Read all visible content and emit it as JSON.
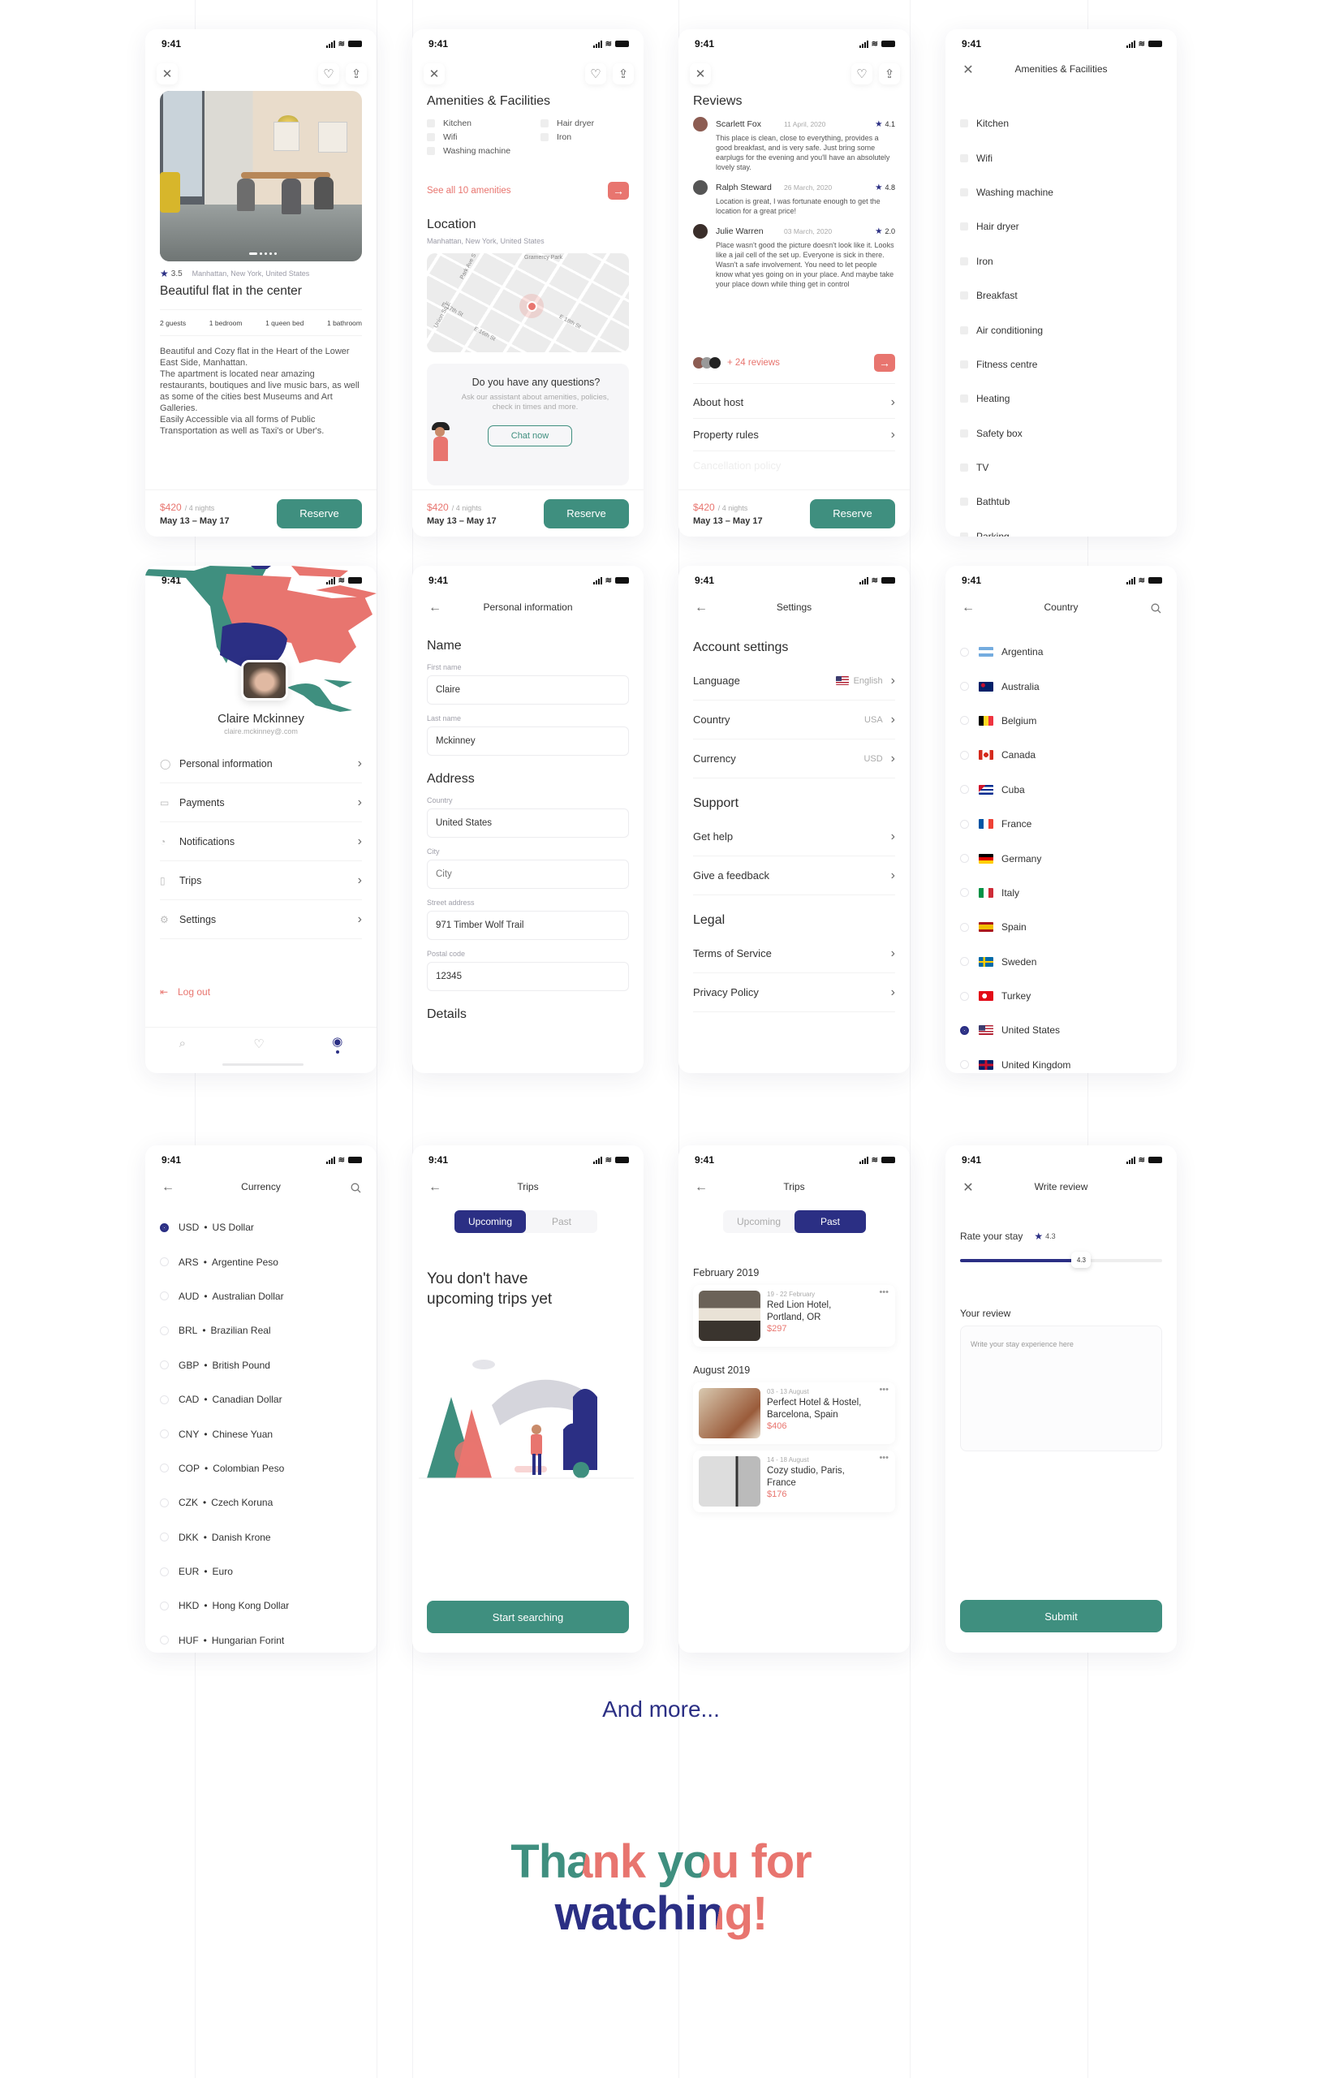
{
  "status": {
    "time": "9:41"
  },
  "colors": {
    "green": "#3f8f7f",
    "coral": "#e8756f",
    "navy": "#2b2f84"
  },
  "listing": {
    "rating": "3.5",
    "location": "Manhattan, New York, United States",
    "title": "Beautiful flat in the center",
    "specs": [
      "2 guests",
      "1 bedroom",
      "1 queen bed",
      "1 bathroom"
    ],
    "description": "Beautiful and Cozy flat in the Heart of the Lower East Side, Manhattan.\nThe apartment is located near amazing restaurants, boutiques and live music bars, as well as some of the cities best Museums and Art Galleries.\nEasily Accessible via all forms of Public Transportation as well as Taxi's or Uber's.",
    "price": "$420",
    "nights": "/ 4 nights",
    "dates": "May 13 – May 17",
    "reserve": "Reserve"
  },
  "amenities_preview": {
    "title": "Amenities & Facilities",
    "items": [
      "Kitchen",
      "Hair dryer",
      "Wifi",
      "Iron",
      "Washing machine"
    ],
    "see_all": "See all 10 amenities",
    "location_title": "Location",
    "location_address": "Manhattan, New York, United States",
    "map_labels": [
      "Gramercy Park",
      "Park Ave S",
      "E 17th St",
      "E 18th St",
      "E 16th St",
      "Union Sq E"
    ],
    "questions_title": "Do you have any questions?",
    "questions_text": "Ask our assistant about amenities, policies, check in times and more.",
    "chat_now": "Chat now"
  },
  "reviews": {
    "title": "Reviews",
    "items": [
      {
        "name": "Scarlett Fox",
        "date": "11 April, 2020",
        "rating": "4.1",
        "text": "This place is clean, close to everything, provides a good breakfast, and is very safe. Just bring some earplugs for the evening and you'll have an absolutely lovely stay."
      },
      {
        "name": "Ralph Steward",
        "date": "26 March, 2020",
        "rating": "4.8",
        "text": "Location is great, I was fortunate enough to get the location for a great price!"
      },
      {
        "name": "Julie Warren",
        "date": "03 March, 2020",
        "rating": "2.0",
        "text": "Place wasn't good the picture doesn't look like it. Looks like a jail cell of the set up. Everyone is sick in there. Wasn't a safe involvement. You need to let people know what yes going on in your place. And maybe take your place down while thing get in control"
      }
    ],
    "more": "+ 24 reviews",
    "about_host": "About host",
    "property_rules": "Property rules",
    "cancellation": "Cancellation policy"
  },
  "amenities_full": {
    "title": "Amenities & Facilities",
    "items": [
      "Kitchen",
      "Wifi",
      "Washing machine",
      "Hair dryer",
      "Iron",
      "Breakfast",
      "Air conditioning",
      "Fitness centre",
      "Heating",
      "Safety box",
      "TV",
      "Bathtub",
      "Parking"
    ]
  },
  "profile": {
    "name": "Claire Mckinney",
    "email": "claire.mckinney@.com",
    "menu": [
      {
        "label": "Personal information",
        "icon": "user-icon"
      },
      {
        "label": "Payments",
        "icon": "card-icon"
      },
      {
        "label": "Notifications",
        "icon": "bell-icon"
      },
      {
        "label": "Trips",
        "icon": "suitcase-icon"
      },
      {
        "label": "Settings",
        "icon": "gear-icon"
      }
    ],
    "logout": "Log out",
    "tabs": [
      "search-icon",
      "heart-icon",
      "profile-icon"
    ],
    "active_tab": "profile-icon"
  },
  "personal_info": {
    "title": "Personal information",
    "name_section": "Name",
    "first_name_label": "First name",
    "first_name": "Claire",
    "last_name_label": "Last name",
    "last_name": "Mckinney",
    "address_section": "Address",
    "country_label": "Country",
    "country": "United States",
    "city_label": "City",
    "city_placeholder": "City",
    "street_label": "Street address",
    "street": "971 Timber Wolf Trail",
    "postal_label": "Postal code",
    "postal": "12345",
    "details_section": "Details"
  },
  "settings": {
    "title": "Settings",
    "account": "Account settings",
    "rows": [
      {
        "label": "Language",
        "value": "English",
        "flag": "flag-us"
      },
      {
        "label": "Country",
        "value": "USA"
      },
      {
        "label": "Currency",
        "value": "USD"
      }
    ],
    "support": "Support",
    "support_rows": [
      "Get help",
      "Give a feedback"
    ],
    "legal": "Legal",
    "legal_rows": [
      "Terms of Service",
      "Privacy Policy"
    ]
  },
  "country": {
    "title": "Country",
    "selected": "United States",
    "items": [
      {
        "name": "Argentina",
        "flag": "flag-ar"
      },
      {
        "name": "Australia",
        "flag": "flag-au"
      },
      {
        "name": "Belgium",
        "flag": "flag-be"
      },
      {
        "name": "Canada",
        "flag": "flag-ca"
      },
      {
        "name": "Cuba",
        "flag": "flag-cu"
      },
      {
        "name": "France",
        "flag": "flag-fr"
      },
      {
        "name": "Germany",
        "flag": "flag-de"
      },
      {
        "name": "Italy",
        "flag": "flag-it"
      },
      {
        "name": "Spain",
        "flag": "flag-es"
      },
      {
        "name": "Sweden",
        "flag": "flag-se"
      },
      {
        "name": "Turkey",
        "flag": "flag-tr"
      },
      {
        "name": "United States",
        "flag": "flag-us"
      },
      {
        "name": "United Kingdom",
        "flag": "flag-gb"
      }
    ]
  },
  "currency": {
    "title": "Currency",
    "selected": "USD",
    "items": [
      {
        "code": "USD",
        "name": "US Dollar"
      },
      {
        "code": "ARS",
        "name": "Argentine Peso"
      },
      {
        "code": "AUD",
        "name": "Australian Dollar"
      },
      {
        "code": "BRL",
        "name": "Brazilian Real"
      },
      {
        "code": "GBP",
        "name": "British Pound"
      },
      {
        "code": "CAD",
        "name": "Canadian Dollar"
      },
      {
        "code": "CNY",
        "name": "Chinese Yuan"
      },
      {
        "code": "COP",
        "name": "Colombian Peso"
      },
      {
        "code": "CZK",
        "name": "Czech Koruna"
      },
      {
        "code": "DKK",
        "name": "Danish Krone"
      },
      {
        "code": "EUR",
        "name": "Euro"
      },
      {
        "code": "HKD",
        "name": "Hong Kong Dollar"
      },
      {
        "code": "HUF",
        "name": "Hungarian Forint"
      }
    ]
  },
  "trips": {
    "title": "Trips",
    "tab_upcoming": "Upcoming",
    "tab_past": "Past",
    "empty_text": "You don't have upcoming trips yet",
    "start_searching": "Start searching",
    "groups": [
      {
        "month": "February 2019",
        "items": [
          {
            "dates": "19 - 22 February",
            "name": "Red Lion Hotel, Portland, OR",
            "price": "$297"
          }
        ]
      },
      {
        "month": "August 2019",
        "items": [
          {
            "dates": "03 - 13 August",
            "name": "Perfect Hotel & Hostel, Barcelona, Spain",
            "price": "$406"
          },
          {
            "dates": "14 - 18 August",
            "name": "Cozy studio, Paris, France",
            "price": "$176"
          }
        ]
      }
    ]
  },
  "write_review": {
    "title": "Write review",
    "rate_label": "Rate your stay",
    "rating": "4.3",
    "slider_fraction": 0.6,
    "review_label": "Your review",
    "placeholder": "Write your stay experience here",
    "submit": "Submit"
  },
  "footer": {
    "and_more": "And more...",
    "thanks_line1": "Thank you for",
    "thanks_line2": "watching!"
  }
}
